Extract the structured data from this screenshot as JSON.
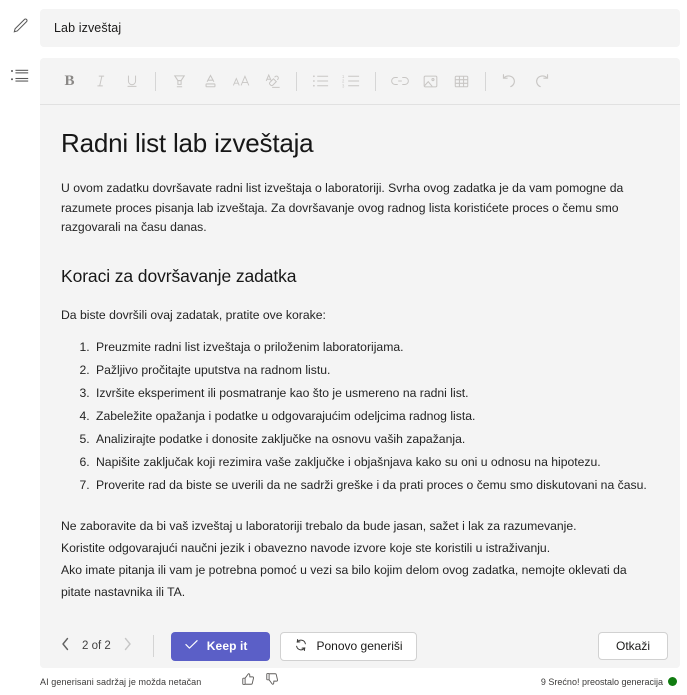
{
  "rail": {
    "edit_icon": "pencil-icon",
    "list_icon": "list-icon"
  },
  "title_field": {
    "value": "Lab izveštaj",
    "placeholder": "Lab izveštaj"
  },
  "toolbar": {
    "items": [
      {
        "name": "bold-button",
        "label": "B"
      },
      {
        "name": "italic-button",
        "label": "I"
      },
      {
        "name": "underline-button",
        "label": "U"
      },
      {
        "name": "highlight-button",
        "label": ""
      },
      {
        "name": "font-color-button",
        "label": ""
      },
      {
        "name": "font-size-button",
        "label": ""
      },
      {
        "name": "clear-formatting-button",
        "label": ""
      },
      {
        "name": "bulleted-list-button",
        "label": ""
      },
      {
        "name": "numbered-list-button",
        "label": ""
      },
      {
        "name": "insert-link-button",
        "label": ""
      },
      {
        "name": "insert-image-button",
        "label": ""
      },
      {
        "name": "insert-table-button",
        "label": ""
      },
      {
        "name": "undo-button",
        "label": ""
      },
      {
        "name": "redo-button",
        "label": ""
      }
    ]
  },
  "document": {
    "heading": "Radni list lab izveštaja",
    "intro": "U ovom zadatku dovršavate radni list izveštaja o laboratoriji. Svrha ovog zadatka je da vam pomogne da razumete proces pisanja lab izveštaja. Za dovršavanje ovog radnog lista koristićete proces o čemu smo razgovarali na času danas.",
    "subheading": "Koraci za dovršavanje zadatka",
    "steps_intro": "Da biste dovršili ovaj zadatak, pratite ove korake:",
    "steps": [
      "Preuzmite radni list izveštaja o priloženim laboratorijama.",
      "Pažljivo pročitajte uputstva na radnom listu.",
      "Izvršite eksperiment ili posmatranje kao što je usmereno na radni list.",
      "Zabeležite opažanja i podatke u odgovarajućim odeljcima radnog lista.",
      "Analizirajte podatke i donosite zaključke na osnovu vaših zapažanja.",
      "Napišite zaključak koji rezimira vaše zaključke i objašnjava kako su oni u odnosu na hipotezu.",
      "Proverite rad da biste se uverili da ne sadrži greške i da prati proces o čemu smo diskutovani na času."
    ],
    "closing": [
      "Ne zaboravite da bi vaš izveštaj u laboratoriji trebalo da bude jasan, sažet i lak za razumevanje.",
      "Koristite odgovarajući naučni jezik i obavezno navode izvore koje ste koristili u istraživanju.",
      "Ako imate pitanja ili vam je potrebna pomoć u vezi sa bilo kojim delom ovog zadatka, nemojte oklevati da pitate nastavnika ili TA."
    ]
  },
  "actions": {
    "pager_label": "2 of 2",
    "prev_icon": "chevron-left-icon",
    "next_icon": "chevron-right-icon",
    "keep_label": "Keep it",
    "keep_icon": "checkmark-icon",
    "regenerate_label": "Ponovo generiši",
    "regenerate_icon": "refresh-icon",
    "cancel_label": "Otkaži"
  },
  "footer": {
    "disclaimer": "AI generisani sadržaj je možda netačan",
    "thumbs_up_icon": "thumbs-up-icon",
    "thumbs_down_icon": "thumbs-down-icon",
    "quota": "9 Srećno! preostalo generacija",
    "status_dot_color": "#107c10"
  },
  "colors": {
    "accent": "#5b5fc7",
    "surface": "#f4f4f4",
    "text": "#242424",
    "status_green": "#107c10"
  }
}
